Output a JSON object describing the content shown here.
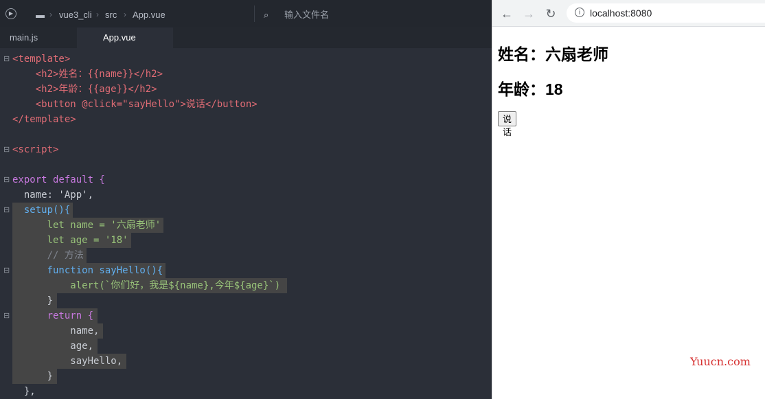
{
  "editor": {
    "breadcrumb": [
      "vue3_cli",
      "src",
      "App.vue"
    ],
    "file_search_placeholder": "输入文件名",
    "tabs": [
      {
        "label": "main.js",
        "active": false
      },
      {
        "label": "App.vue",
        "active": true
      }
    ],
    "code_lines": [
      "<template>",
      "    <h2>姓名：{{name}}</h2>",
      "    <h2>年龄：{{age}}</h2>",
      "    <button @click=\"sayHello\">说话</button>",
      "</template>",
      "",
      "<script>",
      "",
      "export default {",
      "  name: 'App',",
      "  setup(){",
      "      let name = '六扇老师'",
      "      let age = '18'",
      "      // 方法",
      "      function sayHello(){",
      "          alert(`你们好，我是${name},今年${age}`)",
      "      }",
      "      return {",
      "          name,",
      "          age,",
      "          sayHello,",
      "      }",
      "  },"
    ]
  },
  "browser": {
    "url": "localhost:8080",
    "page": {
      "name_heading": "姓名：六扇老师",
      "age_heading": "年龄：18",
      "button_label": "说话"
    },
    "watermark": "Yuucn.com"
  }
}
